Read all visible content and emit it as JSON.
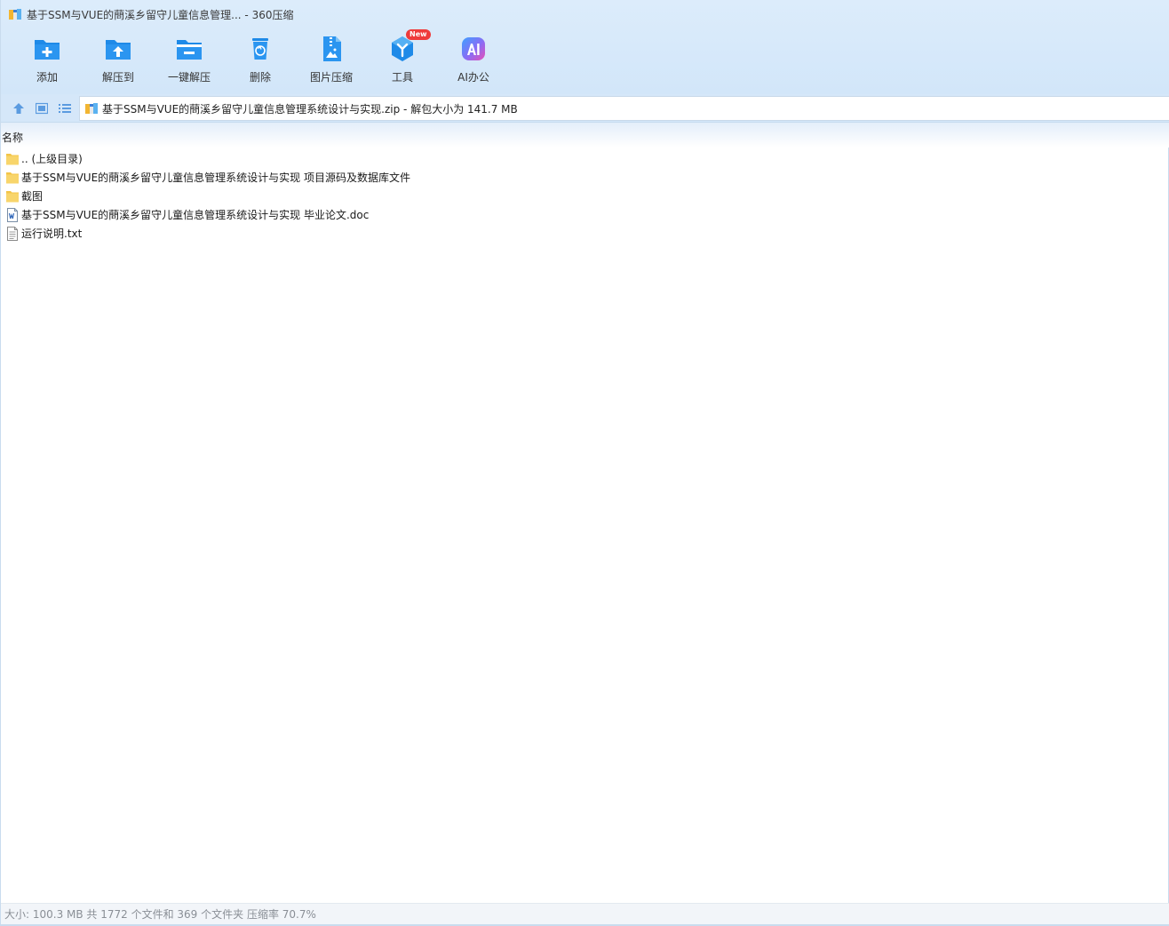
{
  "window": {
    "title": "基于SSM与VUE的蔄溪乡留守儿童信息管理... - 360压缩"
  },
  "toolbar": {
    "items": [
      {
        "label": "添加",
        "icon": "add-folder-icon"
      },
      {
        "label": "解压到",
        "icon": "extract-to-icon"
      },
      {
        "label": "一键解压",
        "icon": "one-click-extract-icon"
      },
      {
        "label": "删除",
        "icon": "trash-icon"
      },
      {
        "label": "图片压缩",
        "icon": "image-compress-icon"
      },
      {
        "label": "工具",
        "icon": "tools-cube-icon",
        "badge": "New"
      },
      {
        "label": "AI办公",
        "icon": "ai-office-icon"
      }
    ]
  },
  "address": {
    "text": "基于SSM与VUE的蔄溪乡留守儿童信息管理系统设计与实现.zip - 解包大小为 141.7 MB"
  },
  "columns": {
    "name": "名称"
  },
  "files": [
    {
      "name": ".. (上级目录)",
      "type": "folder"
    },
    {
      "name": "基于SSM与VUE的蔄溪乡留守儿童信息管理系统设计与实现 项目源码及数据库文件",
      "type": "folder"
    },
    {
      "name": "截图",
      "type": "folder"
    },
    {
      "name": "基于SSM与VUE的蔄溪乡留守儿童信息管理系统设计与实现 毕业论文.doc",
      "type": "doc"
    },
    {
      "name": "运行说明.txt",
      "type": "txt"
    }
  ],
  "status": {
    "text": "大小: 100.3 MB 共 1772 个文件和 369 个文件夹 压缩率 70.7%"
  },
  "colors": {
    "accent": "#1e8ae8",
    "header_bg": "#d5e7f9",
    "folder": "#f8d56b",
    "badge": "#ef3b3b"
  }
}
